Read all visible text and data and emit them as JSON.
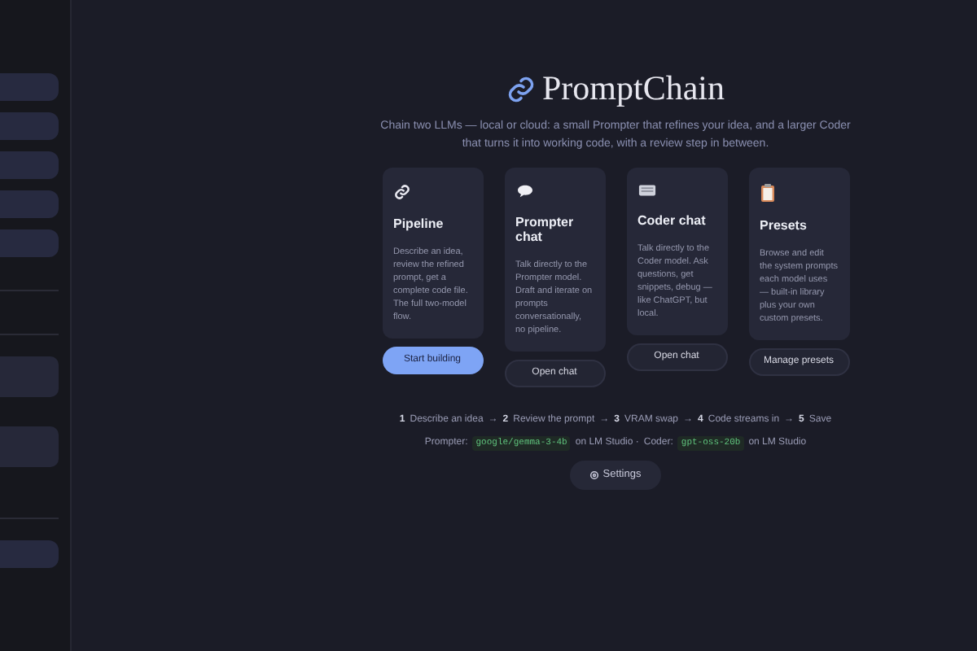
{
  "sidebar": {
    "items": [
      {
        "kind": "pill"
      },
      {
        "kind": "pill"
      },
      {
        "kind": "pill"
      },
      {
        "kind": "pill"
      },
      {
        "kind": "pill"
      },
      {
        "kind": "divider"
      },
      {
        "kind": "divider"
      },
      {
        "kind": "block"
      },
      {
        "kind": "block"
      },
      {
        "kind": "divider"
      },
      {
        "kind": "pill"
      }
    ]
  },
  "header": {
    "title": "PromptChain",
    "subtitle": "Chain two LLMs — local or cloud: a small Prompter that refines your idea, and a larger Coder that turns it into working code, with a review step in between."
  },
  "cards": [
    {
      "kind": "link",
      "title": "Pipeline",
      "description": "Describe an idea, review the refined prompt, get a complete code file. The full two-model flow.",
      "button": "Start building",
      "primary": true
    },
    {
      "kind": "speech",
      "title": "Prompter chat",
      "description": "Talk directly to the Prompter model. Draft and iterate on prompts conversationally, no pipeline.",
      "button": "Open chat",
      "primary": false
    },
    {
      "kind": "keyboard",
      "title": "Coder chat",
      "description": "Talk directly to the Coder model. Ask questions, get snippets, debug — like ChatGPT, but local.",
      "button": "Open chat",
      "primary": false
    },
    {
      "kind": "clipboard",
      "title": "Presets",
      "description": "Browse and edit the system prompts each model uses — built-in library plus your own custom presets.",
      "button": "Manage presets",
      "primary": false
    }
  ],
  "steps": {
    "separator": "→",
    "items": [
      {
        "number": "1",
        "label": "Describe an idea"
      },
      {
        "number": "2",
        "label": "Review the prompt"
      },
      {
        "number": "3",
        "label": "VRAM swap"
      },
      {
        "number": "4",
        "label": "Code streams in"
      },
      {
        "number": "5",
        "label": "Save"
      }
    ]
  },
  "models": [
    {
      "role": "Prompter:",
      "model": "google/gemma-3-4b",
      "host": "on LM Studio ·"
    },
    {
      "role": "Coder:",
      "model": "gpt-oss-20b",
      "host": "on LM Studio"
    }
  ],
  "settings_button": "Settings"
}
